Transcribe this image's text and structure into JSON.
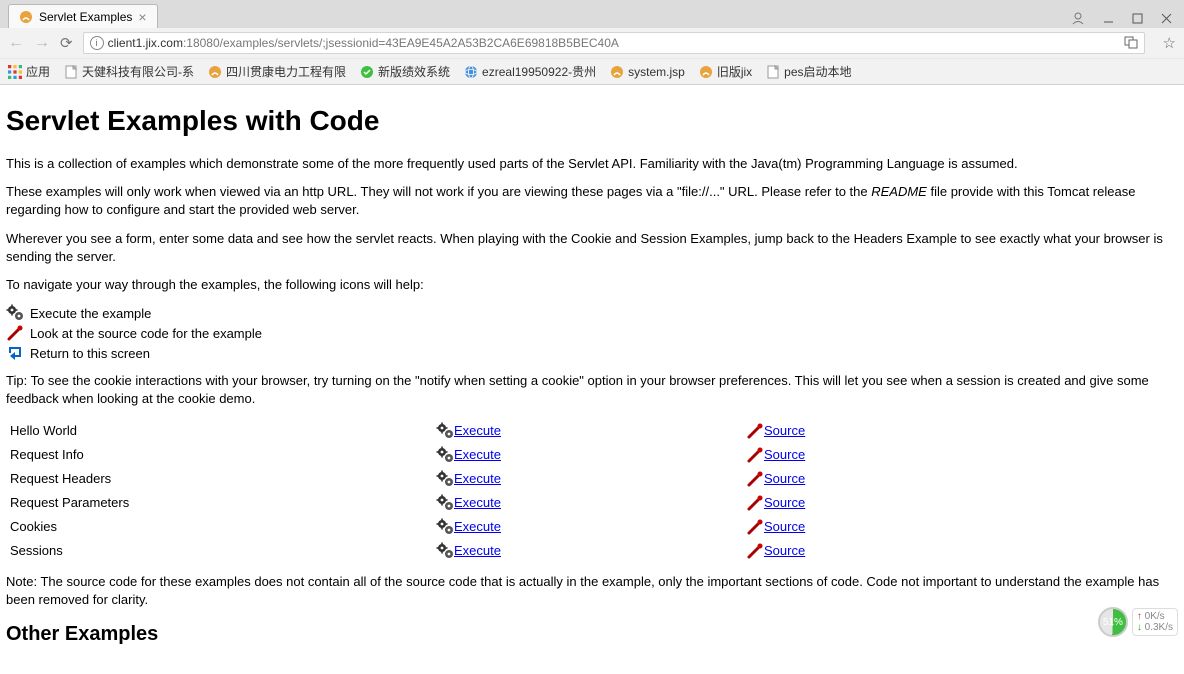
{
  "browser": {
    "tab_title": "Servlet Examples",
    "url_host": "client1.jix.com",
    "url_port_path": ":18080/examples/servlets/;jsessionid=43EA9E45A2A53B2CA6E69818B5BEC40A",
    "bookmarks": {
      "apps": "应用",
      "b1": "天健科技有限公司-系",
      "b2": "四川贯康电力工程有限",
      "b3": "新版绩效系统",
      "b4": "ezreal19950922-贵州",
      "b5": "system.jsp",
      "b6": "旧版jix",
      "b7": "pes启动本地"
    }
  },
  "page": {
    "h1": "Servlet Examples with Code",
    "p1": "This is a collection of examples which demonstrate some of the more frequently used parts of the Servlet API. Familiarity with the Java(tm) Programming Language is assumed.",
    "p2a": "These examples will only work when viewed via an http URL. They will not work if you are viewing these pages via a \"file://...\" URL. Please refer to the ",
    "p2readme": "README",
    "p2b": " file provide with this Tomcat release regarding how to configure and start the provided web server.",
    "p3": "Wherever you see a form, enter some data and see how the servlet reacts. When playing with the Cookie and Session Examples, jump back to the Headers Example to see exactly what your browser is sending the server.",
    "p4": "To navigate your way through the examples, the following icons will help:",
    "legend": {
      "execute": "Execute the example",
      "source": "Look at the source code for the example",
      "return": "Return to this screen"
    },
    "p5": "Tip: To see the cookie interactions with your browser, try turning on the \"notify when setting a cookie\" option in your browser preferences. This will let you see when a session is created and give some feedback when looking at the cookie demo.",
    "examples": [
      {
        "name": "Hello World",
        "exec": "Execute",
        "src": "Source"
      },
      {
        "name": "Request Info",
        "exec": "Execute",
        "src": "Source"
      },
      {
        "name": "Request Headers",
        "exec": "Execute",
        "src": "Source"
      },
      {
        "name": "Request Parameters",
        "exec": "Execute",
        "src": "Source"
      },
      {
        "name": "Cookies",
        "exec": "Execute",
        "src": "Source"
      },
      {
        "name": "Sessions",
        "exec": "Execute",
        "src": "Source"
      }
    ],
    "note": "Note: The source code for these examples does not contain all of the source code that is actually in the example, only the important sections of code. Code not important to understand the example has been removed for clarity.",
    "h2": "Other Examples"
  },
  "netmon": {
    "pct": "51%",
    "up": "0K/s",
    "dn": "0.3K/s"
  }
}
